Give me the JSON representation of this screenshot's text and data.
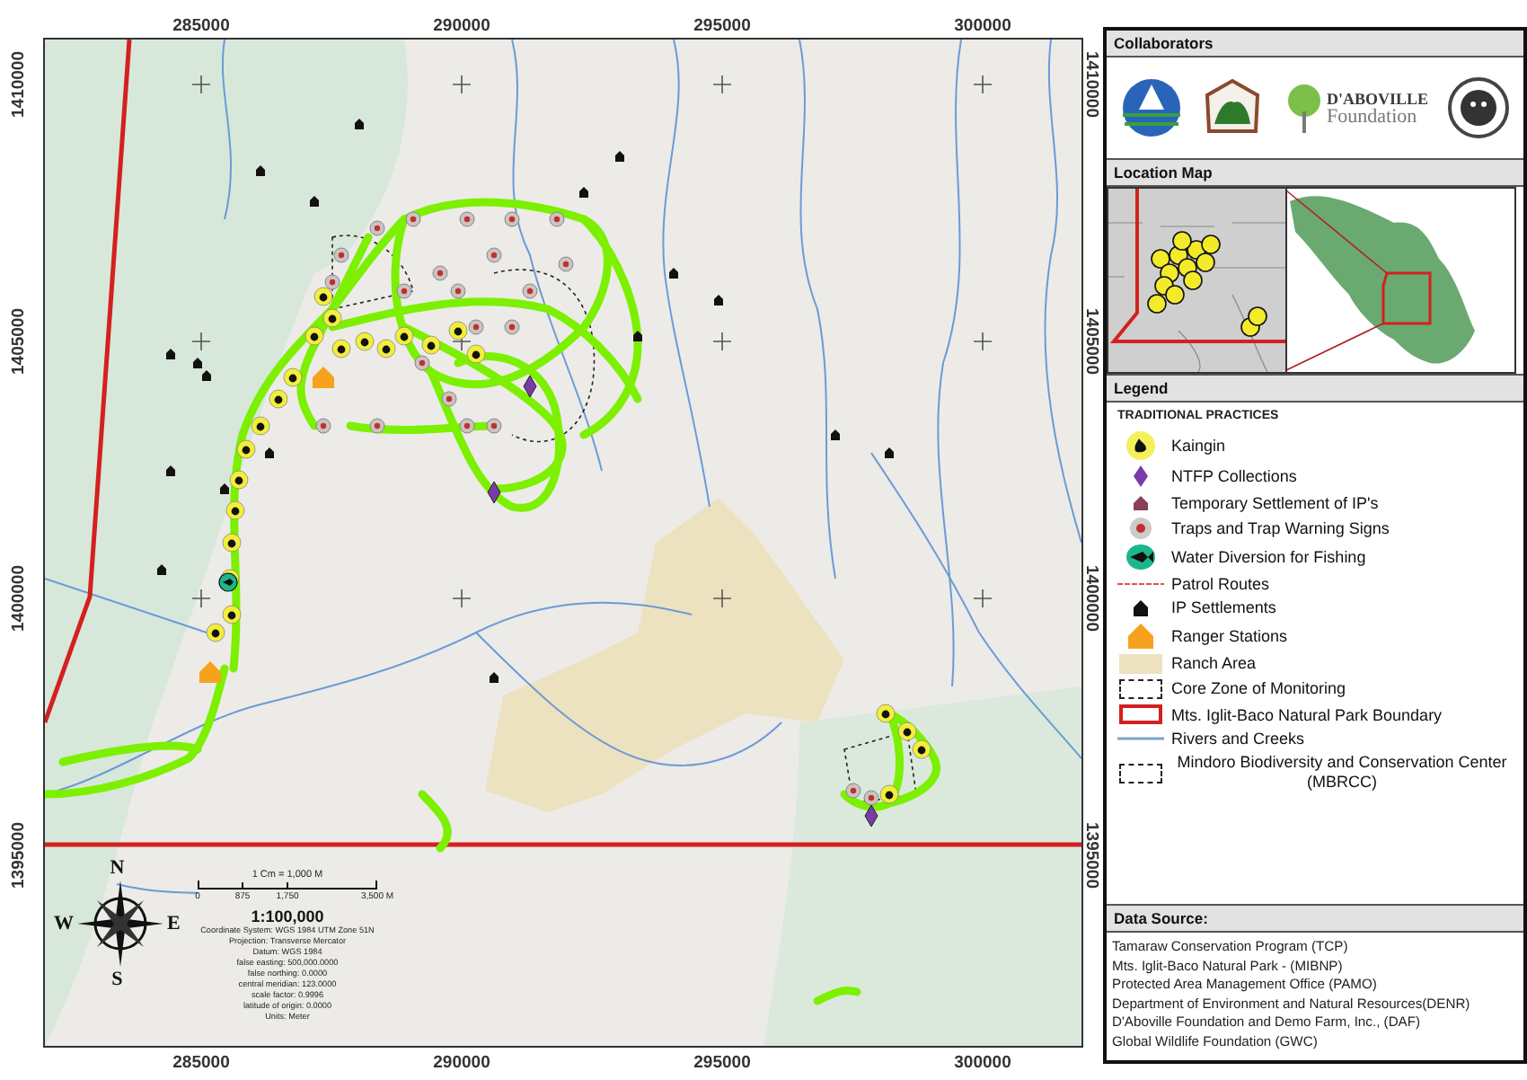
{
  "map": {
    "top_ticks": [
      "285000",
      "290000",
      "295000",
      "300000"
    ],
    "bottom_ticks": [
      "285000",
      "290000",
      "295000",
      "300000"
    ],
    "left_ticks": [
      "1410000",
      "1405000",
      "1400000",
      "1395000"
    ],
    "right_ticks": [
      "1410000",
      "1405000",
      "1400000",
      "1395000"
    ],
    "scale": {
      "caption": "1 Cm = 1,000 M",
      "bar_labels": [
        "0",
        "875",
        "1,750",
        "3,500 M"
      ],
      "ratio": "1:100,000",
      "notes": [
        "Coordinate System: WGS 1984 UTM Zone 51N",
        "Projection: Transverse Mercator",
        "Datum: WGS 1984",
        "false easting: 500,000.0000",
        "false northing: 0.0000",
        "central meridian: 123.0000",
        "scale factor: 0.9996",
        "latitude of origin: 0.0000",
        "Units: Meter"
      ]
    },
    "compass": {
      "north": "N",
      "east": "E",
      "south": "S",
      "west": "W"
    }
  },
  "panel": {
    "collaborators": {
      "title": "Collaborators",
      "logo_text": [
        "D'ABOVILLE",
        "Foundation"
      ]
    },
    "location_map": {
      "title": "Location Map"
    },
    "legend": {
      "title": "Legend",
      "subtitle": "TRADITIONAL PRACTICES",
      "items": [
        {
          "kind": "kaingin",
          "label": "Kaingin"
        },
        {
          "kind": "ntfp",
          "label": "NTFP Collections"
        },
        {
          "kind": "temp-settlement",
          "label": "Temporary Settlement of IP's"
        },
        {
          "kind": "trap",
          "label": "Traps and Trap Warning Signs"
        },
        {
          "kind": "water-diversion",
          "label": "Water Diversion for Fishing"
        },
        {
          "kind": "patrol-route",
          "label": "Patrol Routes"
        },
        {
          "kind": "ip-settlement",
          "label": "IP Settlements"
        },
        {
          "kind": "ranger-station",
          "label": "Ranger Stations"
        },
        {
          "kind": "ranch",
          "label": "Ranch Area"
        },
        {
          "kind": "core-zone",
          "label": "Core Zone of Monitoring"
        },
        {
          "kind": "boundary",
          "label": "Mts. Iglit-Baco Natural Park Boundary"
        },
        {
          "kind": "river",
          "label": "Rivers and Creeks"
        },
        {
          "kind": "mbrcc",
          "label": "Mindoro Biodiversity and Conservation Center  (MBRCC)"
        }
      ]
    },
    "data_source": {
      "title": "Data Source:",
      "entries": [
        "Tamaraw Conservation Program (TCP)",
        "Mts. Iglit-Baco Natural Park - (MIBNP)",
        "Protected Area Management Office (PAMO)",
        "Department of Environment and Natural Resources(DENR)",
        "D'Aboville Foundation and Demo Farm, Inc., (DAF)",
        "Global Wildlife Foundation (GWC)"
      ]
    }
  }
}
